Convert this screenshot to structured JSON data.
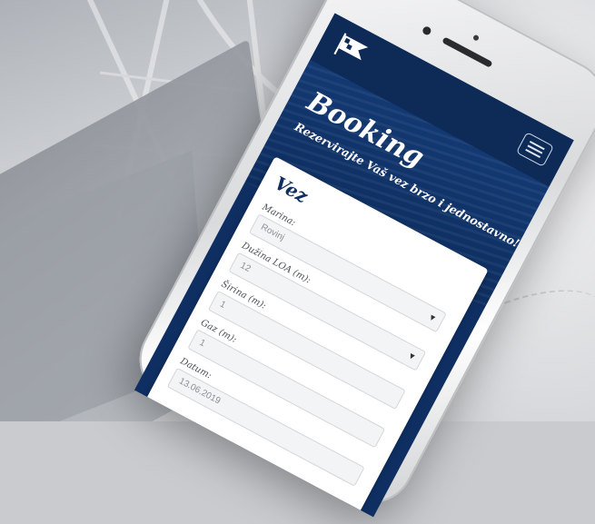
{
  "header": {
    "logo_icon": "flag-logo-icon",
    "menu_icon": "hamburger-menu-icon"
  },
  "hero": {
    "title": "Booking",
    "subtitle": "Rezervirajte Vaš vez brzo i jednostavno!"
  },
  "form": {
    "title": "Vez",
    "fields": [
      {
        "label": "Marina:",
        "value": "Rovinj",
        "type": "select"
      },
      {
        "label": "Dužina LOA (m):",
        "value": "12",
        "type": "select"
      },
      {
        "label": "Širina (m):",
        "value": "1",
        "type": "input"
      },
      {
        "label": "Gaz (m):",
        "value": "1",
        "type": "input"
      },
      {
        "label": "Datum:",
        "value": "13.06.2019",
        "type": "input"
      }
    ]
  },
  "colors": {
    "primary": "#0f2f63",
    "card": "#ffffff"
  }
}
